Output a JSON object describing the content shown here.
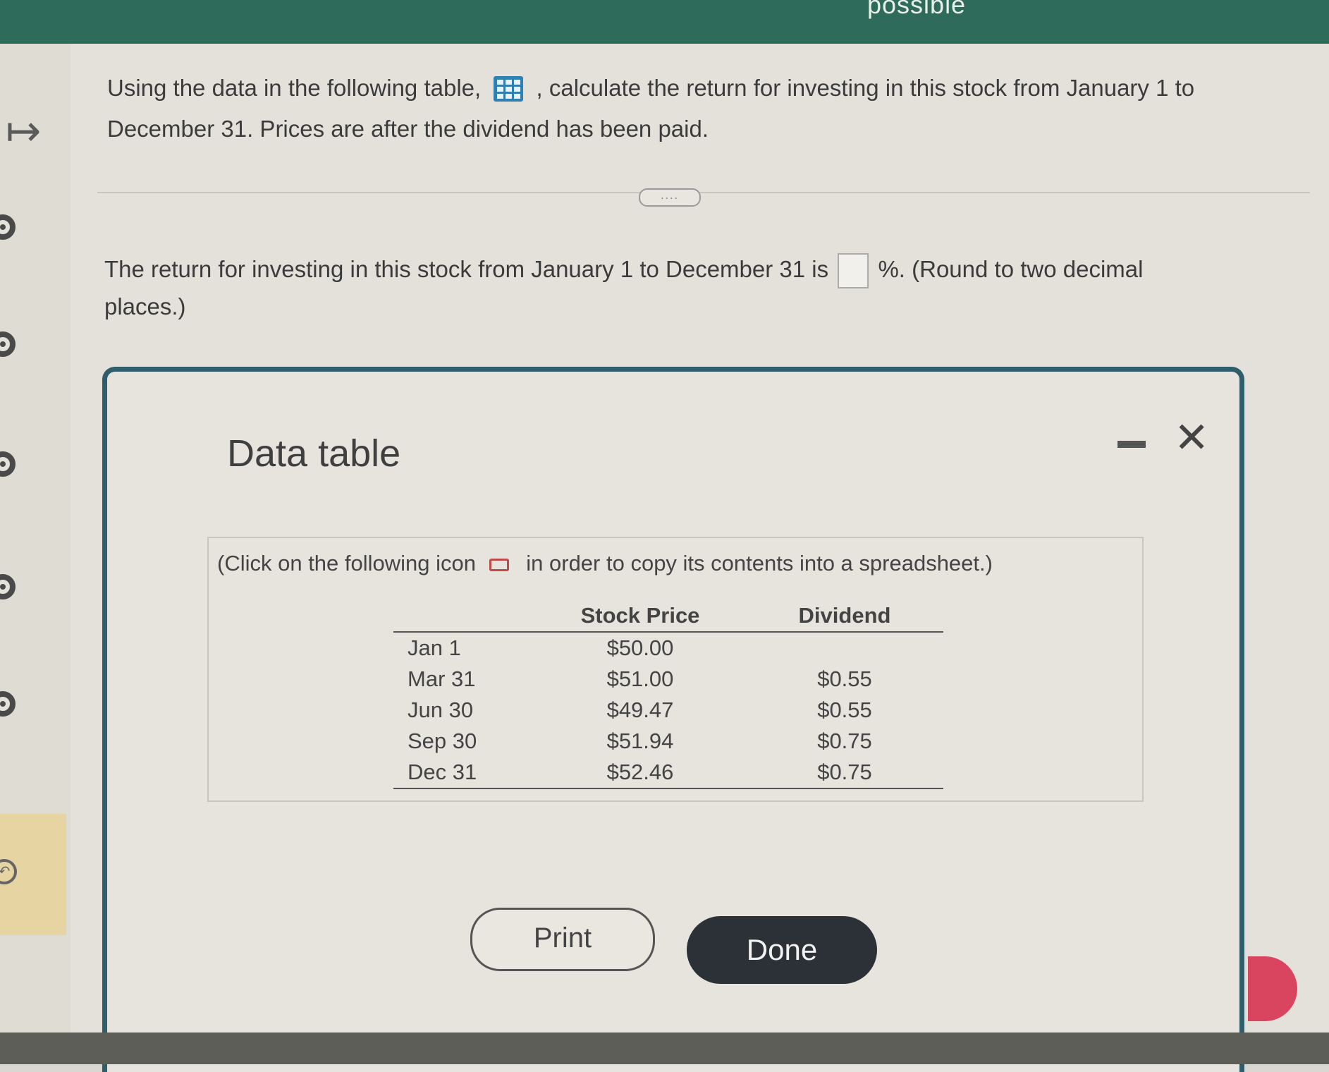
{
  "topbar": {
    "text": "possible"
  },
  "question": {
    "text_before": "Using the data in the following table,",
    "text_after": ", calculate the return for investing in this stock from January 1 to December 31. Prices are after the dividend has been paid.",
    "icon": "table-grid-icon"
  },
  "more_button": {
    "label": "...."
  },
  "answer": {
    "text_before": "The return for investing in this stock from January 1 to December 31 is",
    "input_value": "",
    "text_after": "%. (Round to two decimal places.)"
  },
  "modal": {
    "title": "Data table",
    "minimize_icon": "minimize-icon",
    "close_icon": "close-icon",
    "note_before": "(Click on the following icon",
    "note_after": "in order to copy its contents into a spreadsheet.)",
    "copy_icon": "copy-icon",
    "table": {
      "headers": [
        "",
        "Stock Price",
        "Dividend"
      ],
      "rows": [
        [
          "Jan 1",
          "$50.00",
          ""
        ],
        [
          "Mar 31",
          "$51.00",
          "$0.55"
        ],
        [
          "Jun 30",
          "$49.47",
          "$0.55"
        ],
        [
          "Sep 30",
          "$51.94",
          "$0.75"
        ],
        [
          "Dec 31",
          "$52.46",
          "$0.75"
        ]
      ]
    },
    "print_label": "Print",
    "done_label": "Done"
  },
  "colors": {
    "topbar": "#2e6b5a",
    "modal_border": "#2f5d6b",
    "done_button": "#2b3137",
    "copy_icon": "#c04a4a",
    "pink_tab": "#d9445f"
  }
}
